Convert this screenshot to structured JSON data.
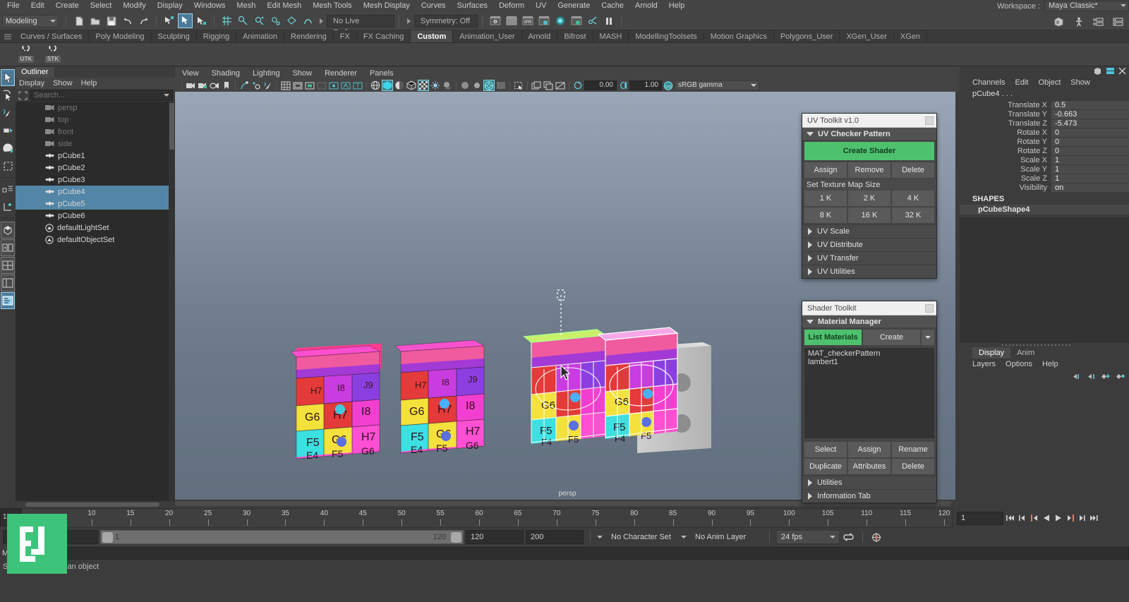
{
  "menubar": {
    "items": [
      "File",
      "Edit",
      "Create",
      "Select",
      "Modify",
      "Display",
      "Windows",
      "Mesh",
      "Edit Mesh",
      "Mesh Tools",
      "Mesh Display",
      "Curves",
      "Surfaces",
      "Deform",
      "UV",
      "Generate",
      "Cache",
      "Arnold",
      "Help"
    ],
    "workspace_label": "Workspace :",
    "workspace_value": "Maya Classic*"
  },
  "statusbar": {
    "menuset": "Modeling",
    "live_surface": "No Live Surface",
    "symmetry": "Symmetry: Off",
    "icons": [
      "new-scene-icon",
      "open-scene-icon",
      "save-scene-icon",
      "undo-icon",
      "redo-icon",
      "select-by-hierarchy-icon",
      "select-by-object-icon",
      "select-by-component-icon",
      "snap-to-grid-icon",
      "snap-to-curve-icon",
      "snap-to-point-icon",
      "snap-to-projected-center-icon",
      "snap-to-view-plane-icon",
      "make-live-icon",
      "render-view-icon",
      "render-current-frame-icon",
      "ipr-render-icon",
      "render-settings-icon",
      "hypershade-icon",
      "render-sequence-icon",
      "render-setup-icon",
      "pause-icon"
    ],
    "right_icons": [
      "toggle-attribute-editor-icon",
      "toggle-tool-settings-icon",
      "toggle-channel-box-icon",
      "toggle-layer-editor-icon"
    ]
  },
  "shelf": {
    "tabs": [
      "Curves / Surfaces",
      "Poly Modeling",
      "Sculpting",
      "Rigging",
      "Animation",
      "Rendering",
      "FX",
      "FX Caching",
      "Custom",
      "Animation_User",
      "Arnold",
      "Bifrost",
      "MASH",
      "ModellingToolsets",
      "Motion Graphics",
      "Polygons_User",
      "XGen_User",
      "XGen"
    ],
    "active_tab": "Custom",
    "buttons": [
      {
        "caption": "UTK",
        "icon": "uv-toolkit-shelf-icon"
      },
      {
        "caption": "STK",
        "icon": "shader-toolkit-shelf-icon"
      }
    ]
  },
  "toolbox": {
    "items": [
      "select-tool-icon",
      "lasso-select-tool-icon",
      "paint-select-tool-icon",
      "move-tool-icon",
      "rotate-tool-icon",
      "scale-tool-icon",
      "last-tool-icon",
      "show-manipulator-icon"
    ],
    "layout_items": [
      "single-perspective-layout-icon",
      "two-pane-layout-icon",
      "four-pane-layout-icon",
      "persp-outliner-layout-icon",
      "persp-graph-layout-icon"
    ],
    "active_index": 0
  },
  "outliner": {
    "tab_label": "Outliner",
    "menus": [
      "Display",
      "Show",
      "Help"
    ],
    "search_placeholder": "Search...",
    "items": [
      {
        "label": "persp",
        "icon": "camera-icon",
        "dim": true,
        "selected": false
      },
      {
        "label": "top",
        "icon": "camera-icon",
        "dim": true,
        "selected": false
      },
      {
        "label": "front",
        "icon": "camera-icon",
        "dim": true,
        "selected": false
      },
      {
        "label": "side",
        "icon": "camera-icon",
        "dim": true,
        "selected": false
      },
      {
        "label": "pCube1",
        "icon": "mesh-icon",
        "dim": false,
        "selected": false
      },
      {
        "label": "pCube2",
        "icon": "mesh-icon",
        "dim": false,
        "selected": false
      },
      {
        "label": "pCube3",
        "icon": "mesh-icon",
        "dim": false,
        "selected": false
      },
      {
        "label": "pCube4",
        "icon": "mesh-icon",
        "dim": false,
        "selected": true
      },
      {
        "label": "pCube5",
        "icon": "mesh-icon",
        "dim": false,
        "selected": true
      },
      {
        "label": "pCube6",
        "icon": "mesh-icon",
        "dim": false,
        "selected": false
      },
      {
        "label": "defaultLightSet",
        "icon": "set-icon",
        "dim": false,
        "selected": false
      },
      {
        "label": "defaultObjectSet",
        "icon": "set-icon",
        "dim": false,
        "selected": false
      }
    ]
  },
  "viewport": {
    "menus": [
      "View",
      "Shading",
      "Lighting",
      "Show",
      "Renderer",
      "Panels"
    ],
    "exposure_value": "0.00",
    "gamma_value": "1.00",
    "color_space": "sRGB gamma",
    "camera_label": "persp",
    "objects": [
      {
        "name": "pCube1",
        "type": "checker",
        "selected": false
      },
      {
        "name": "pCube2",
        "type": "checker",
        "selected": false
      },
      {
        "name": "pCube3",
        "type": "grey",
        "selected": false
      },
      {
        "name": "pCube4",
        "type": "checker",
        "selected": true
      },
      {
        "name": "pCube5",
        "type": "checker",
        "selected": true
      },
      {
        "name": "pCube6",
        "type": "grey",
        "selected": false
      }
    ],
    "checker_labels": [
      "G6",
      "H7",
      "I8",
      "F5",
      "G6",
      "H7",
      "E4",
      "F5",
      "G6",
      "J9"
    ]
  },
  "uv_toolkit": {
    "title": "UV Toolkit v1.0",
    "section": "UV Checker Pattern",
    "create_shader": "Create Shader",
    "actions": [
      "Assign",
      "Remove",
      "Delete"
    ],
    "map_size_label": "Set Texture Map Size",
    "map_sizes_row1": [
      "1 K",
      "2 K",
      "4 K"
    ],
    "map_sizes_row2": [
      "8 K",
      "16 K",
      "32 K"
    ],
    "collapsed_sections": [
      "UV Scale",
      "UV Distribute",
      "UV Transfer",
      "UV Utilities"
    ]
  },
  "shader_toolkit": {
    "title": "Shader Toolkit",
    "section": "Material Manager",
    "tabs": [
      "List Materials",
      "Create"
    ],
    "active_tab": "List Materials",
    "materials": [
      "MAT_checkerPattern",
      "lambert1"
    ],
    "actions_row1": [
      "Select",
      "Assign",
      "Rename"
    ],
    "actions_row2": [
      "Duplicate",
      "Attributes",
      "Delete"
    ],
    "collapsed_sections": [
      "Utilities",
      "Information Tab"
    ]
  },
  "channel_box": {
    "menus": [
      "Channels",
      "Edit",
      "Object",
      "Show"
    ],
    "object_name": "pCube4 . . .",
    "attributes": [
      {
        "label": "Translate X",
        "value": "0.5"
      },
      {
        "label": "Translate Y",
        "value": "-0.663"
      },
      {
        "label": "Translate Z",
        "value": "-5.473"
      },
      {
        "label": "Rotate X",
        "value": "0"
      },
      {
        "label": "Rotate Y",
        "value": "0"
      },
      {
        "label": "Rotate Z",
        "value": "0"
      },
      {
        "label": "Scale X",
        "value": "1"
      },
      {
        "label": "Scale Y",
        "value": "1"
      },
      {
        "label": "Scale Z",
        "value": "1"
      },
      {
        "label": "Visibility",
        "value": "on"
      }
    ],
    "shapes_header": "SHAPES",
    "shape_name": "pCubeShape4"
  },
  "layer_editor": {
    "tabs": [
      "Display",
      "Anim"
    ],
    "active_tab": "Display",
    "menus": [
      "Layers",
      "Options",
      "Help"
    ],
    "icons": [
      "layer-move-left-icon",
      "layer-move-right-icon",
      "new-layer-icon",
      "new-layer-from-selection-icon"
    ]
  },
  "timeline": {
    "current_frame": "1",
    "ticks": [
      10,
      15,
      20,
      25,
      30,
      35,
      40,
      45,
      50,
      55,
      60,
      65,
      70,
      75,
      80,
      85,
      90,
      95,
      100,
      105,
      110,
      115,
      120
    ],
    "playhead_field": "1",
    "playback_buttons": [
      "go-to-start-icon",
      "step-back-keyframe-icon",
      "step-back-frame-icon",
      "play-backwards-icon",
      "play-forwards-icon",
      "step-forward-frame-icon",
      "step-forward-keyframe-icon",
      "go-to-end-icon"
    ]
  },
  "range_slider": {
    "start_field": "1",
    "range_start_label": "1",
    "range_end_label": "120",
    "anim_start": "120",
    "anim_end": "200",
    "character_set": "No Character Set",
    "anim_layer": "No Anim Layer",
    "fps": "24 fps",
    "loop_icon": "loop-playback-icon",
    "anim_pref_icon": "animation-preferences-icon"
  },
  "command_line": {
    "prefix": "MEL",
    "value": ""
  },
  "status_message": "Select Tool: select an object",
  "colors": {
    "accent_green": "#4ec16e",
    "selection_blue": "#5285a6",
    "highlight_cyan": "#7fd3de",
    "panel_bg": "#3c3c3c",
    "watermark_green": "#3ec47a"
  },
  "watermark": {
    "text": "EJ"
  }
}
